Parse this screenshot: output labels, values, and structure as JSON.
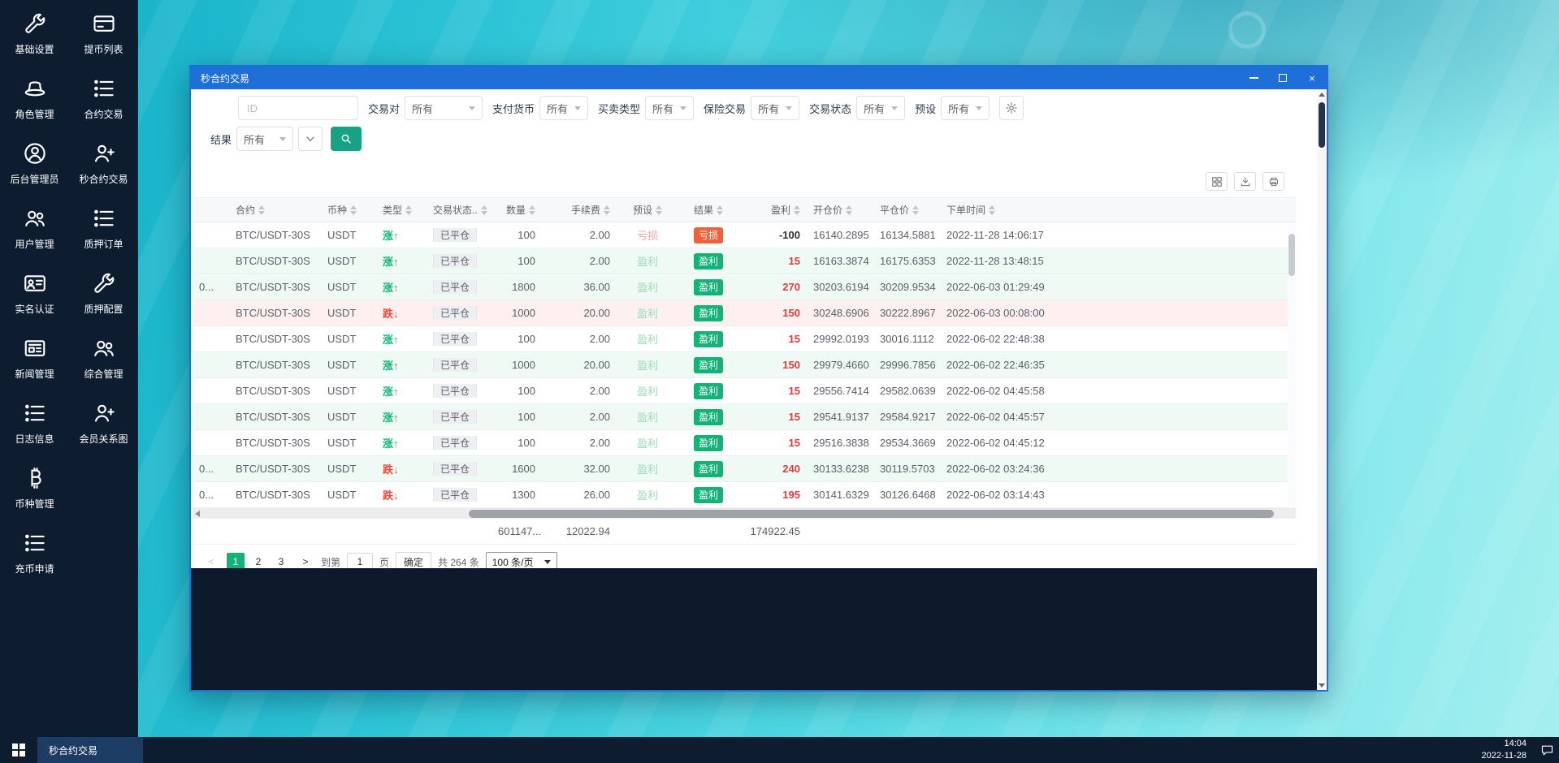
{
  "colors": {
    "titlebar": "#1f6fd8",
    "accent_green": "#13b377",
    "badge_loss": "#f0603a",
    "preset_loss": "#f59e9e",
    "preset_win": "#9fd9bd",
    "profit_red": "#e23a3a",
    "sidebar_bg": "#0e1c30",
    "row_green": "#f0faf4",
    "row_red": "#fdf0ee"
  },
  "desktop": {
    "taskbar": {
      "task_label": "秒合约交易",
      "time": "14:04",
      "date": "2022-11-28"
    }
  },
  "sidebar": {
    "items": [
      {
        "name": "basic-settings",
        "icon": "wrench-icon",
        "label": "基础设置"
      },
      {
        "name": "withdraw-list",
        "icon": "card-icon",
        "label": "提币列表"
      },
      {
        "name": "role-management",
        "icon": "hat-icon",
        "label": "角色管理"
      },
      {
        "name": "contract-trade",
        "icon": "list-icon",
        "label": "合约交易"
      },
      {
        "name": "admin-management",
        "icon": "user-circle-icon",
        "label": "后台管理员"
      },
      {
        "name": "second-contract-trade",
        "icon": "user-plus-icon",
        "label": "秒合约交易"
      },
      {
        "name": "user-management",
        "icon": "users-icon",
        "label": "用户管理"
      },
      {
        "name": "pledge-orders",
        "icon": "list-icon",
        "label": "质押订单"
      },
      {
        "name": "realname-auth",
        "icon": "id-card-icon",
        "label": "实名认证"
      },
      {
        "name": "pledge-config",
        "icon": "wrench-icon",
        "label": "质押配置"
      },
      {
        "name": "news-management",
        "icon": "newspaper-icon",
        "label": "新闻管理"
      },
      {
        "name": "general-management",
        "icon": "users-icon",
        "label": "综合管理"
      },
      {
        "name": "log-info",
        "icon": "list-icon",
        "label": "日志信息"
      },
      {
        "name": "member-relations",
        "icon": "user-plus-icon",
        "label": "会员关系图"
      },
      {
        "name": "coin-management",
        "icon": "bitcoin-icon",
        "label": "币种管理"
      },
      {
        "name": "deposit-requests",
        "icon": "list-icon",
        "label": "充币申请"
      }
    ]
  },
  "window": {
    "title": "秒合约交易",
    "filters": {
      "id_placeholder": "ID",
      "selects": [
        {
          "name": "trading-pair",
          "label": "交易对",
          "value": "所有"
        },
        {
          "name": "pay-currency",
          "label": "支付货币",
          "value": "所有"
        },
        {
          "name": "trade-side",
          "label": "买卖类型",
          "value": "所有"
        },
        {
          "name": "insurance",
          "label": "保险交易",
          "value": "所有"
        },
        {
          "name": "trade-status",
          "label": "交易状态",
          "value": "所有"
        },
        {
          "name": "preset",
          "label": "预设",
          "value": "所有"
        }
      ],
      "result": {
        "name": "result",
        "label": "结果",
        "value": "所有"
      }
    },
    "toolbar": {
      "icons": [
        "columns-icon",
        "download-icon",
        "printer-icon"
      ]
    },
    "table": {
      "columns": [
        "",
        "合约",
        "币种",
        "类型",
        "交易状态..",
        "数量",
        "手续费",
        "预设",
        "结果",
        "盈利",
        "开仓价",
        "平仓价",
        "下单时间"
      ],
      "rows": [
        {
          "partial": "",
          "contract": "BTC/USDT-30S",
          "currency": "USDT",
          "type": "涨↑",
          "dir": "up",
          "status": "已平仓",
          "qty": "100",
          "fee": "2.00",
          "preset": "亏损",
          "result": "亏损",
          "profit": "-100",
          "open": "16140.2895",
          "close": "16134.5881",
          "time": "2022-11-28 14:06:17",
          "tint": "white"
        },
        {
          "partial": "",
          "contract": "BTC/USDT-30S",
          "currency": "USDT",
          "type": "涨↑",
          "dir": "up",
          "status": "已平仓",
          "qty": "100",
          "fee": "2.00",
          "preset": "盈利",
          "result": "盈利",
          "profit": "15",
          "open": "16163.3874",
          "close": "16175.6353",
          "time": "2022-11-28 13:48:15",
          "tint": "green"
        },
        {
          "partial": "0...",
          "contract": "BTC/USDT-30S",
          "currency": "USDT",
          "type": "涨↑",
          "dir": "up",
          "status": "已平仓",
          "qty": "1800",
          "fee": "36.00",
          "preset": "盈利",
          "result": "盈利",
          "profit": "270",
          "open": "30203.6194",
          "close": "30209.9534",
          "time": "2022-06-03 01:29:49",
          "tint": "green"
        },
        {
          "partial": "",
          "contract": "BTC/USDT-30S",
          "currency": "USDT",
          "type": "跌↓",
          "dir": "down",
          "status": "已平仓",
          "qty": "1000",
          "fee": "20.00",
          "preset": "盈利",
          "result": "盈利",
          "profit": "150",
          "open": "30248.6906",
          "close": "30222.8967",
          "time": "2022-06-03 00:08:00",
          "tint": "red"
        },
        {
          "partial": "",
          "contract": "BTC/USDT-30S",
          "currency": "USDT",
          "type": "涨↑",
          "dir": "up",
          "status": "已平仓",
          "qty": "100",
          "fee": "2.00",
          "preset": "盈利",
          "result": "盈利",
          "profit": "15",
          "open": "29992.0193",
          "close": "30016.1112",
          "time": "2022-06-02 22:48:38",
          "tint": "white"
        },
        {
          "partial": "",
          "contract": "BTC/USDT-30S",
          "currency": "USDT",
          "type": "涨↑",
          "dir": "up",
          "status": "已平仓",
          "qty": "1000",
          "fee": "20.00",
          "preset": "盈利",
          "result": "盈利",
          "profit": "150",
          "open": "29979.4660",
          "close": "29996.7856",
          "time": "2022-06-02 22:46:35",
          "tint": "green"
        },
        {
          "partial": "",
          "contract": "BTC/USDT-30S",
          "currency": "USDT",
          "type": "涨↑",
          "dir": "up",
          "status": "已平仓",
          "qty": "100",
          "fee": "2.00",
          "preset": "盈利",
          "result": "盈利",
          "profit": "15",
          "open": "29556.7414",
          "close": "29582.0639",
          "time": "2022-06-02 04:45:58",
          "tint": "white"
        },
        {
          "partial": "",
          "contract": "BTC/USDT-30S",
          "currency": "USDT",
          "type": "涨↑",
          "dir": "up",
          "status": "已平仓",
          "qty": "100",
          "fee": "2.00",
          "preset": "盈利",
          "result": "盈利",
          "profit": "15",
          "open": "29541.9137",
          "close": "29584.9217",
          "time": "2022-06-02 04:45:57",
          "tint": "green"
        },
        {
          "partial": "",
          "contract": "BTC/USDT-30S",
          "currency": "USDT",
          "type": "涨↑",
          "dir": "up",
          "status": "已平仓",
          "qty": "100",
          "fee": "2.00",
          "preset": "盈利",
          "result": "盈利",
          "profit": "15",
          "open": "29516.3838",
          "close": "29534.3669",
          "time": "2022-06-02 04:45:12",
          "tint": "white"
        },
        {
          "partial": "0...",
          "contract": "BTC/USDT-30S",
          "currency": "USDT",
          "type": "跌↓",
          "dir": "down",
          "status": "已平仓",
          "qty": "1600",
          "fee": "32.00",
          "preset": "盈利",
          "result": "盈利",
          "profit": "240",
          "open": "30133.6238",
          "close": "30119.5703",
          "time": "2022-06-02 03:24:36",
          "tint": "green"
        },
        {
          "partial": "0...",
          "contract": "BTC/USDT-30S",
          "currency": "USDT",
          "type": "跌↓",
          "dir": "down",
          "status": "已平仓",
          "qty": "1300",
          "fee": "26.00",
          "preset": "盈利",
          "result": "盈利",
          "profit": "195",
          "open": "30141.6329",
          "close": "30126.6468",
          "time": "2022-06-02 03:14:43",
          "tint": "white"
        }
      ],
      "summary": {
        "qty": "601147...",
        "fee": "12022.94",
        "profit": "174922.45"
      }
    },
    "pagination": {
      "prev_label": "<",
      "next_label": ">",
      "pages": [
        "1",
        "2",
        "3"
      ],
      "active": "1",
      "goto_label": "到第",
      "goto_value": "1",
      "page_word": "页",
      "confirm_label": "确定",
      "total_label": "共 264 条",
      "page_size_label": "100 条/页"
    }
  }
}
